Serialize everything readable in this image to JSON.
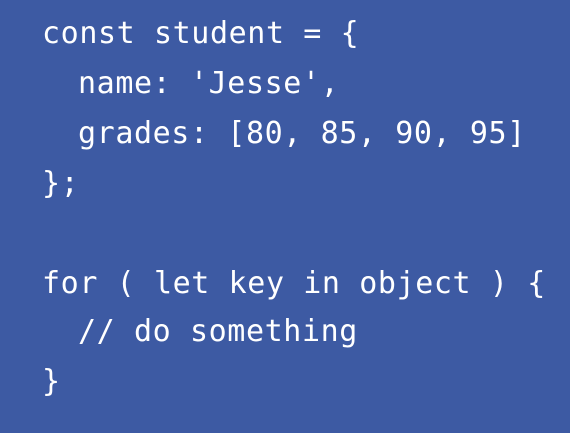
{
  "code": {
    "background_color": "#3d5aa3",
    "text_color": "#ffffff",
    "lines": [
      "const student = {",
      "name: 'Jesse',",
      "grades: [80, 85, 90, 95]",
      "};",
      "",
      "for ( let key in object ) {",
      "// do something",
      "}"
    ]
  }
}
